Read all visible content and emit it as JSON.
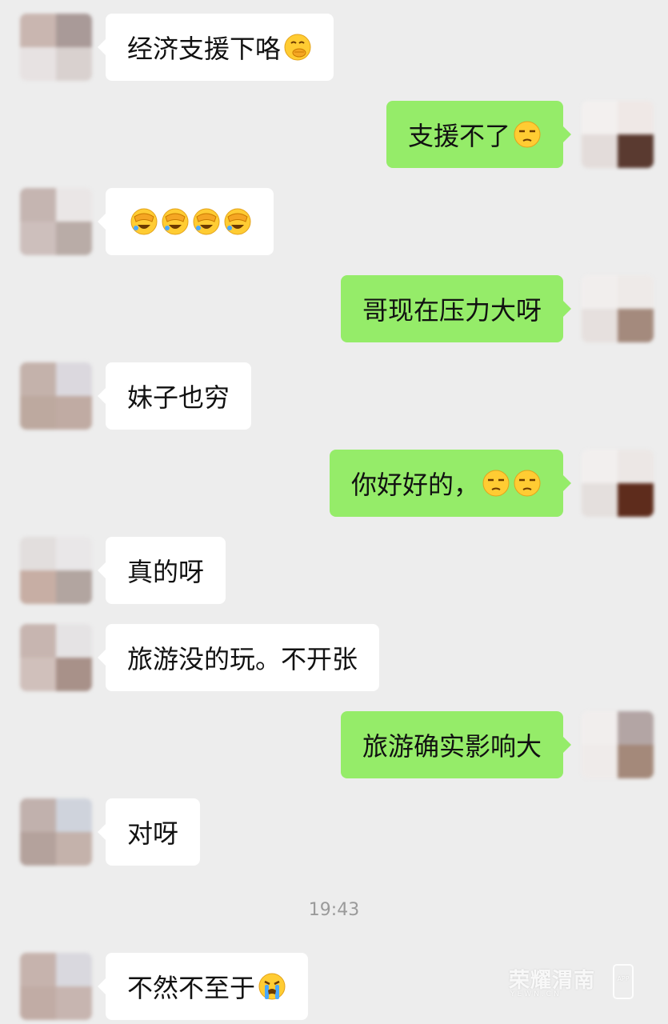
{
  "timestamp": "19:43",
  "messages": [
    {
      "side": "left",
      "text": "经济支援下咯",
      "emojis": [
        "face-with-hand-over-mouth"
      ]
    },
    {
      "side": "right",
      "text": "支援不了",
      "emojis": [
        "unamused-face"
      ]
    },
    {
      "side": "left",
      "text": "",
      "emojis": [
        "facepalm-face",
        "facepalm-face",
        "facepalm-face",
        "facepalm-face"
      ]
    },
    {
      "side": "right",
      "text": "哥现在压力大呀",
      "emojis": []
    },
    {
      "side": "left",
      "text": "妹子也穷",
      "emojis": []
    },
    {
      "side": "right",
      "text": "你好好的，",
      "emojis": [
        "unamused-face",
        "unamused-face"
      ]
    },
    {
      "side": "left",
      "text": "真的呀",
      "emojis": []
    },
    {
      "side": "left",
      "text": "旅游没的玩。不开张",
      "emojis": []
    },
    {
      "side": "right",
      "text": "旅游确实影响大",
      "emojis": []
    },
    {
      "side": "left",
      "text": "对呀",
      "emojis": []
    },
    {
      "side": "left",
      "text": "不然不至于",
      "emojis": [
        "crying-face"
      ]
    }
  ],
  "watermark": {
    "title": "荣耀渭南",
    "subtitle": "YEWN.CN",
    "badge": "APP"
  },
  "colors": {
    "background": "#ededed",
    "incoming_bubble": "#ffffff",
    "outgoing_bubble": "#95ec69"
  }
}
